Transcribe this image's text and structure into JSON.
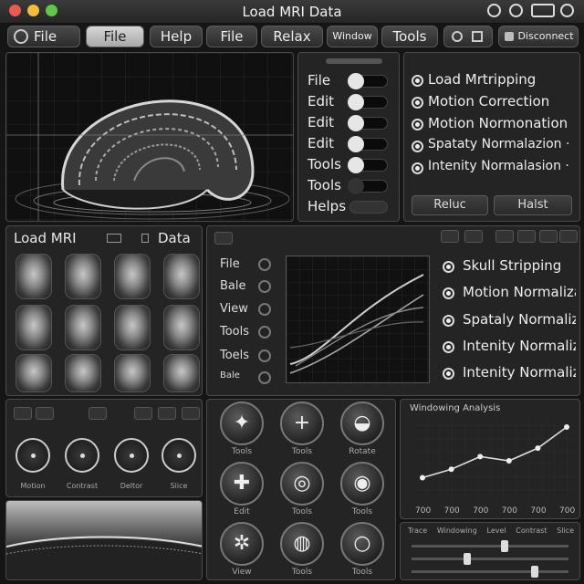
{
  "window": {
    "title": "Load MRI Data"
  },
  "toolbar": {
    "buttons": [
      "File",
      "File",
      "Help",
      "File",
      "Relax",
      "Window",
      "Tools",
      "",
      "Disconnect"
    ]
  },
  "settings": {
    "items": [
      "File",
      "Edit",
      "Edit",
      "Edit",
      "Tools",
      "Tools",
      "Helps"
    ],
    "toggles": [
      true,
      true,
      true,
      true,
      true,
      false,
      false
    ]
  },
  "pipeline": {
    "options": [
      "Load Mrtripping",
      "Motion Correction",
      "Motion Normonation",
      "Spataty Normalazion ·",
      "Intenity Normalasion ·"
    ],
    "buttons": [
      "Reluc",
      "Halst"
    ]
  },
  "thumbs": {
    "header_left": "Load MRI",
    "header_right": "Data"
  },
  "graph": {
    "menu": [
      "File",
      "Bale",
      "View",
      "Tools",
      "Toels",
      "Bale"
    ],
    "steps": [
      "Skull Stripping",
      "Motion Normalization",
      "Spataly Normalization",
      "Intenity Normalization",
      "Intenity Normalization"
    ]
  },
  "dials": {
    "labels": [
      "Motion",
      "Contrast",
      "Deltor",
      "Slice"
    ]
  },
  "actions": {
    "labels": [
      "Tools",
      "Tools",
      "Rotate",
      "Edit",
      "Tools",
      "Tools",
      "View",
      "Tools",
      "Tools"
    ]
  },
  "trend": {
    "title": "Windowing Analysis",
    "tick_labels": [
      "700",
      "700",
      "700",
      "700",
      "700",
      "700"
    ],
    "chart_data": {
      "type": "line",
      "x": [
        1,
        2,
        3,
        4,
        5,
        6
      ],
      "values": [
        2,
        3,
        4.5,
        4,
        5.5,
        8
      ]
    }
  },
  "sliders": {
    "labels": [
      "Trace",
      "Windowing",
      "Level",
      "Contrast",
      "Slice"
    ],
    "values": [
      0.6,
      0.35,
      0.8
    ]
  }
}
